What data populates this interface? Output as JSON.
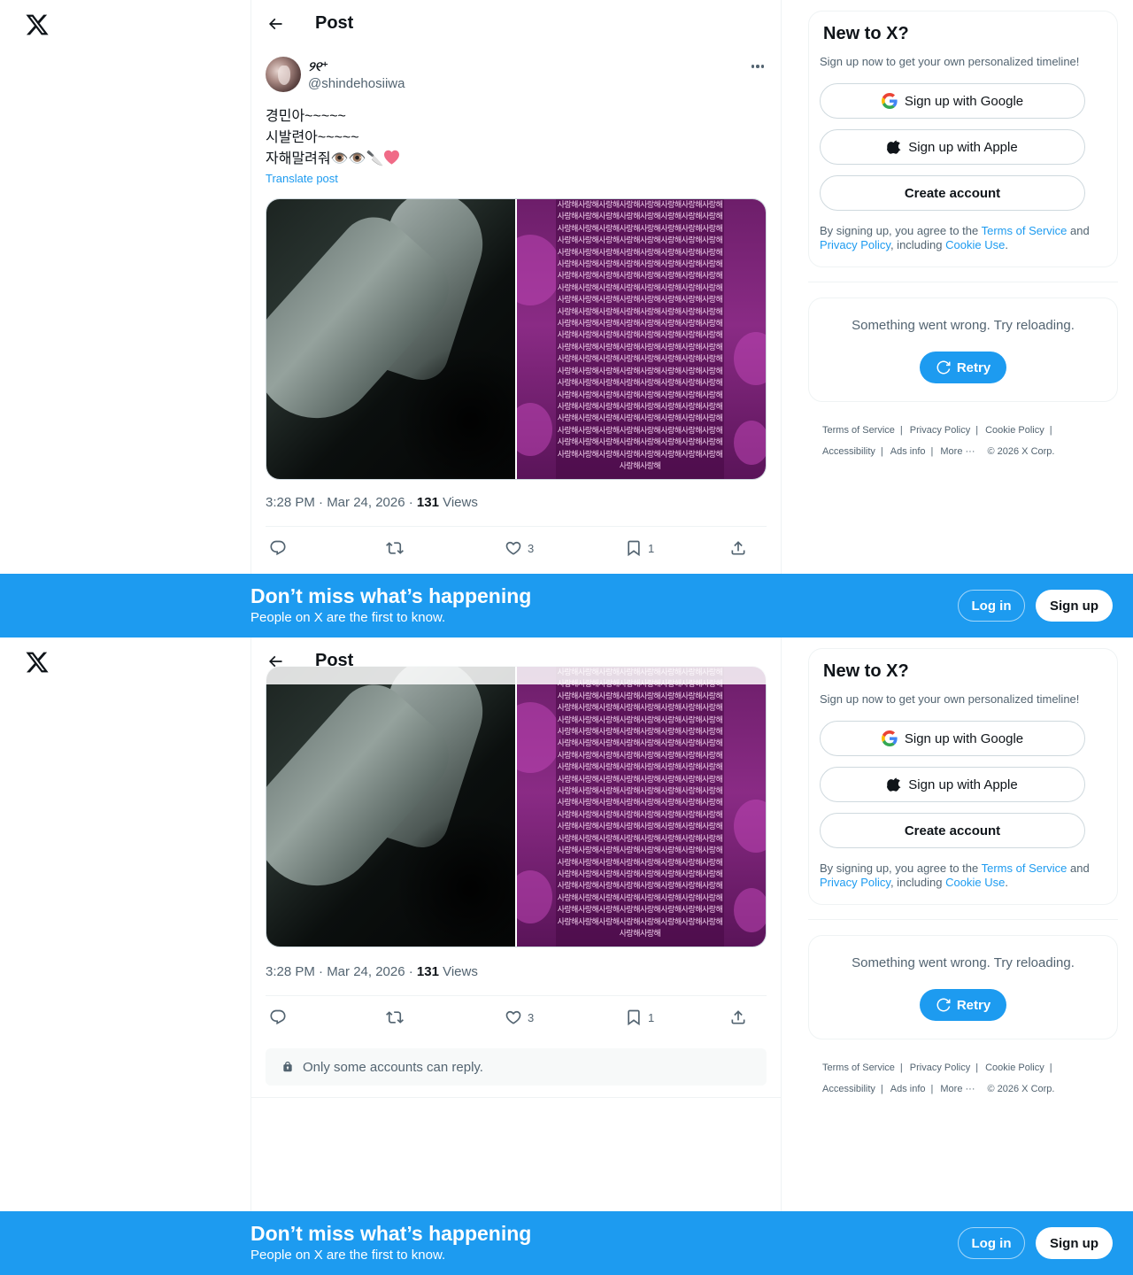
{
  "header": {
    "title": "Post"
  },
  "post": {
    "display_name": "୨୧⁺",
    "handle": "@shindehosiiwa",
    "lines": [
      "경민아~~~~~",
      "시발련아~~~~~",
      "자해말려줘👁️👁️🔪"
    ],
    "translate_label": "Translate post",
    "media_text": "사랑해사랑해사랑해사랑해사랑해사랑해사랑해사랑해사랑해사랑해사랑해사랑해사랑해사랑해사랑해사랑해사랑해사랑해사랑해사랑해사랑해사랑해사랑해사랑해사랑해사랑해사랑해사랑해사랑해사랑해사랑해사랑해사랑해사랑해사랑해사랑해사랑해사랑해사랑해사랑해사랑해사랑해사랑해사랑해사랑해사랑해사랑해사랑해사랑해사랑해사랑해사랑해사랑해사랑해사랑해사랑해사랑해사랑해사랑해사랑해사랑해사랑해사랑해사랑해사랑해사랑해사랑해사랑해사랑해사랑해사랑해사랑해사랑해사랑해사랑해사랑해사랑해사랑해사랑해사랑해사랑해사랑해사랑해사랑해사랑해사랑해사랑해사랑해사랑해사랑해사랑해사랑해사랑해사랑해사랑해사랑해사랑해사랑해사랑해사랑해사랑해사랑해사랑해사랑해사랑해사랑해사랑해사랑해사랑해사랑해사랑해사랑해사랑해사랑해사랑해사랑해사랑해사랑해사랑해사랑해사랑해사랑해사랑해사랑해사랑해사랑해사랑해사랑해사랑해사랑해사랑해사랑해사랑해사랑해사랑해사랑해사랑해사랑해사랑해사랑해사랑해사랑해사랑해사랑해사랑해사랑해사랑해사랑해사랑해사랑해사랑해사랑해사랑해사랑해사랑해사랑해사랑해사랑해사랑해사랑해사랑해사랑해사랑해사랑해사랑해사랑해사랑해사랑해사랑해사랑해사랑해사랑해사랑해사랑해사랑해사랑해사랑해사랑해",
    "time": "3:28 PM · Mar 24, 2026 · ",
    "views_count": "131",
    "views_label": " Views",
    "likes": "3",
    "bookmarks": "1",
    "reply_restriction": "Only some accounts can reply."
  },
  "sidebar": {
    "title": "New to X?",
    "subtitle": "Sign up now to get your own personalized timeline!",
    "google_label": "Sign up with Google",
    "apple_label": "Sign up with Apple",
    "create_label": "Create account",
    "legal_prefix": "By signing up, you agree to the ",
    "tos": "Terms of Service",
    "and": " and ",
    "privacy": "Privacy Policy",
    "including": ", including ",
    "cookie": "Cookie Use",
    "period": ".",
    "error_text": "Something went wrong. Try reloading.",
    "retry_label": "Retry"
  },
  "footer": {
    "terms": "Terms of Service",
    "privacy": "Privacy Policy",
    "cookie": "Cookie Policy",
    "accessibility": "Accessibility",
    "ads": "Ads info",
    "more": "More ···",
    "copyright": "© 2026 X Corp."
  },
  "banner": {
    "title": "Don’t miss what’s happening",
    "subtitle": "People on X are the first to know.",
    "login": "Log in",
    "signup": "Sign up"
  },
  "colors": {
    "accent": "#1d9bf0",
    "text": "#0f1419",
    "muted": "#536471"
  }
}
